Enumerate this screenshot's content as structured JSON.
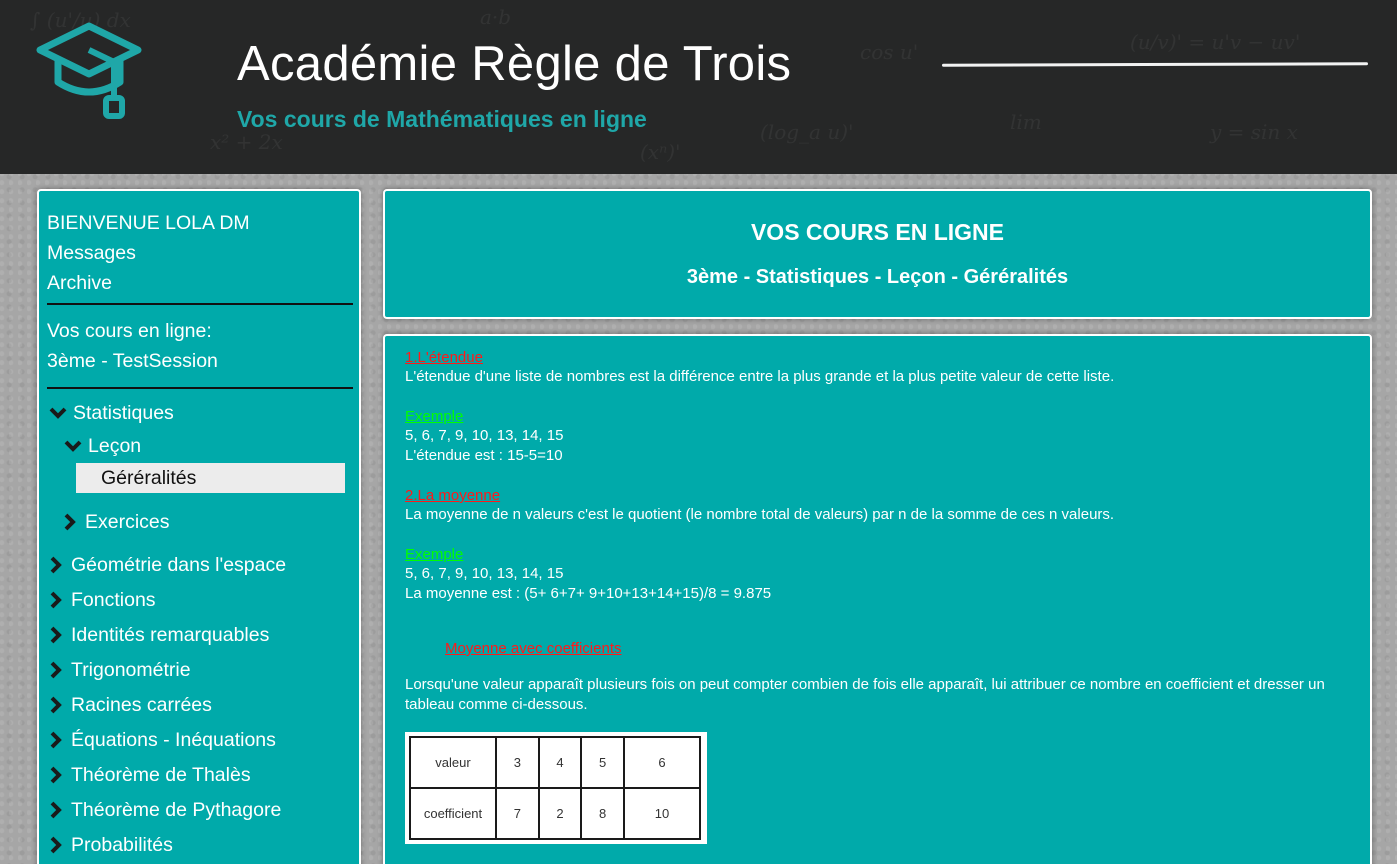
{
  "header": {
    "title": "Académie Règle de Trois",
    "subtitle": "Vos cours de Mathématiques en ligne",
    "logo_icon": "graduation-cap-icon",
    "accent_color": "#1fa7a8"
  },
  "sidebar": {
    "user_menu": {
      "welcome": "BIENVENUE LOLA DM",
      "messages": "Messages",
      "archive": "Archive"
    },
    "courses_label": "Vos cours en ligne:",
    "session": "3ème - TestSession",
    "tree": {
      "statistiques": "Statistiques",
      "lecon": "Leçon",
      "generalites": "Géréralités",
      "exercices": "Exercices"
    },
    "chapters": [
      "Géométrie dans l'espace",
      "Fonctions",
      "Identités remarquables",
      "Trigonométrie",
      "Racines carrées",
      "Équations - Inéquations",
      "Théorème de Thalès",
      "Théorème de Pythagore",
      "Probabilités"
    ]
  },
  "title_panel": {
    "heading": "VOS COURS EN LIGNE",
    "breadcrumb": "3ème - Statistiques - Leçon - Géréralités"
  },
  "lesson": {
    "s1_title": "1.L'étendue",
    "s1_text": "L'étendue d'une liste de nombres est la différence entre la plus grande et la plus petite valeur de cette liste.",
    "example_label": "Exemple",
    "s1_example_values": "5, 6, 7, 9, 10, 13, 14, 15",
    "s1_example_result": "L'étendue est : 15-5=10",
    "s2_title": "2.La moyenne",
    "s2_text": "La moyenne de n valeurs c'est le quotient (le nombre total de valeurs) par n de la somme de ces n valeurs.",
    "s2_example_values": "5, 6, 7, 9, 10, 13, 14, 15",
    "s2_example_result": "La moyenne est : (5+ 6+7+ 9+10+13+14+15)/8 = 9.875",
    "s3_title": "Moyenne avec coefficients",
    "s3_text": "Lorsqu'une valeur apparaît plusieurs fois on peut compter combien de fois elle apparaît, lui attribuer ce nombre en coefficient et dresser un tableau comme ci-dessous.",
    "table": {
      "row1_label": "valeur",
      "row1": [
        "3",
        "4",
        "5",
        "6"
      ],
      "row2_label": "coefficient",
      "row2": [
        "7",
        "2",
        "8",
        "10"
      ]
    }
  },
  "colors": {
    "panel_bg": "#00aaaa",
    "link_red": "#ff1a1a",
    "link_green": "#00ff00",
    "header_bg": "#262727"
  }
}
